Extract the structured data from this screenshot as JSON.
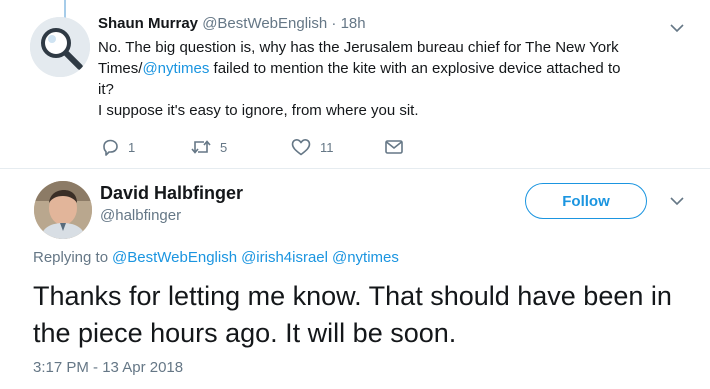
{
  "parent_tweet": {
    "author_name": "Shaun Murray",
    "author_handle": "@BestWebEnglish",
    "separator": "·",
    "time": "18h",
    "line1": "No. The big question is, why has the Jerusalem bureau chief for The New York",
    "line2_prefix": "Times/",
    "line2_mention": "@nytimes",
    "line2_suffix": " failed to mention the kite with an explosive device attached to",
    "line3": "it?",
    "line4": "I suppose it's easy to ignore, from where you sit.",
    "actions": {
      "reply_count": "1",
      "retweet_count": "5",
      "like_count": "11"
    }
  },
  "main_tweet": {
    "author_name": "David Halbfinger",
    "author_handle": "@halbfinger",
    "follow_label": "Follow",
    "replying_prefix": "Replying to",
    "replying_to": [
      "@BestWebEnglish",
      "@irish4israel",
      "@nytimes"
    ],
    "text": "Thanks for letting me know. That should have been in the piece hours ago. It will be soon.",
    "timestamp": "3:17 PM - 13 Apr 2018"
  },
  "icons": {
    "reply": "reply-icon",
    "retweet": "retweet-icon",
    "like": "heart-icon",
    "dm": "envelope-icon",
    "menu": "chevron-down-icon"
  },
  "colors": {
    "accent": "#1b95e0",
    "muted": "#657786",
    "text": "#14171a",
    "thread_line": "#a6cce9"
  }
}
